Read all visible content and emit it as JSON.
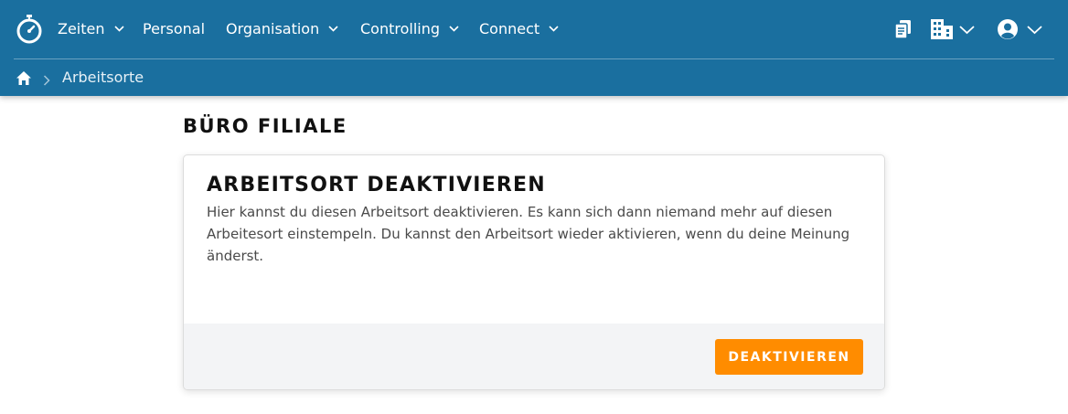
{
  "nav": {
    "items": [
      {
        "label": "Zeiten",
        "dropdown": true
      },
      {
        "label": "Personal",
        "dropdown": false
      },
      {
        "label": "Organisation",
        "dropdown": true
      },
      {
        "label": "Controlling",
        "dropdown": true
      },
      {
        "label": "Connect",
        "dropdown": true
      }
    ],
    "icons": [
      "stopwatch-logo-icon",
      "documents-icon",
      "building-icon",
      "user-avatar-icon"
    ]
  },
  "breadcrumb": {
    "current": "Arbeitsorte"
  },
  "page": {
    "title": "BÜRO FILIALE"
  },
  "card": {
    "title": "ARBEITSORT DEAKTIVIEREN",
    "text": "Hier kannst du diesen Arbeitsort deaktivieren. Es kann sich dann niemand mehr auf diesen Arbeitesort einstempeln. Du kannst den Arbeitsort wieder aktivieren, wenn du deine Meinung änderst.",
    "button_label": "DEAKTIVIEREN"
  },
  "colors": {
    "header": "#1a6f9f",
    "accent": "#ff8c00",
    "footer": "#f3f4f6"
  }
}
